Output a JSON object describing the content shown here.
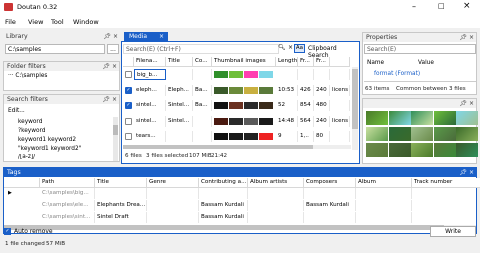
{
  "window": {
    "title": "Doutan 0.32"
  },
  "menu": [
    "File",
    "View",
    "Tool",
    "Window"
  ],
  "library": {
    "title": "Library",
    "path": "C:\\samples",
    "browse": "..."
  },
  "folder_filters": {
    "title": "Folder filters",
    "item": "··· C:\\samples"
  },
  "search_filters": {
    "title": "Search filters",
    "edit": "Edit...",
    "items": [
      "keyword",
      "?keyword",
      "keyword1 keyword2",
      "\"keyword1 keyword2\"",
      "/[a-z]/"
    ]
  },
  "media": {
    "tab": "Media",
    "search_placeholder": "Search(E) (Ctrl+F)",
    "aa": "Aa",
    "clipboard": "Clipboard Search",
    "columns": [
      "Filena...",
      "Title",
      "Co...",
      "Thumbnail images",
      "Length",
      "Fr...",
      "Fr..."
    ],
    "rows": [
      {
        "checked": false,
        "file": "big_b...",
        "title": "",
        "co": "",
        "length": "",
        "fr1": "",
        "fr2": "",
        "extra": ""
      },
      {
        "checked": true,
        "file": "eleph...",
        "title": "Eleph...",
        "co": "Ba...",
        "length": "10:53",
        "fr1": "426",
        "fr2": "240",
        "extra": "licens"
      },
      {
        "checked": true,
        "file": "sintel...",
        "title": "Sintel...",
        "co": "Ba...",
        "length": "52",
        "fr1": "854",
        "fr2": "480",
        "extra": ""
      },
      {
        "checked": false,
        "file": "sintel...",
        "title": "Sintel...",
        "co": "",
        "length": "14:48",
        "fr1": "564",
        "fr2": "240",
        "extra": "licens"
      },
      {
        "checked": false,
        "file": "tears...",
        "title": "",
        "co": "",
        "length": "9",
        "fr1": "1,..",
        "fr2": "80",
        "extra": ""
      }
    ],
    "status": {
      "files": "6 files",
      "selected": "3 files selected",
      "size": "107 MiB",
      "time": "21:42"
    }
  },
  "properties": {
    "title": "Properties",
    "search": "Search(E)",
    "col_name": "Name",
    "col_value": "Value",
    "row": "format (Format)",
    "status_items": "63 items",
    "status_common": "Common between 3 files"
  },
  "tags": {
    "title": "Tags",
    "columns": [
      "Path",
      "Title",
      "Genre",
      "Contributing a...",
      "Album artists",
      "Composers",
      "Album",
      "Track number",
      "Co"
    ],
    "rows": [
      {
        "path": "C:\\samples\\big...",
        "title": "TEST",
        "genre": "",
        "contrib": "",
        "album_artists": "",
        "composers": "",
        "album": "",
        "track": "",
        "co": ""
      },
      {
        "path": "C:\\samples\\ele...",
        "title": "Elephants Drea...",
        "genre": "",
        "contrib": "Bassam Kurdali",
        "album_artists": "",
        "composers": "Bassam Kurdali",
        "album": "",
        "track": "",
        "co": "lice"
      },
      {
        "path": "C:\\samples\\sint...",
        "title": "Sintel Draft",
        "genre": "",
        "contrib": "Bassam Kurdali",
        "album_artists": "",
        "composers": "",
        "album": "",
        "track": "",
        "co": ""
      }
    ],
    "auto_remove": "Auto remove",
    "write": "Write"
  },
  "status_bar": {
    "changed": "1 file changed",
    "size": "57 MiB"
  }
}
